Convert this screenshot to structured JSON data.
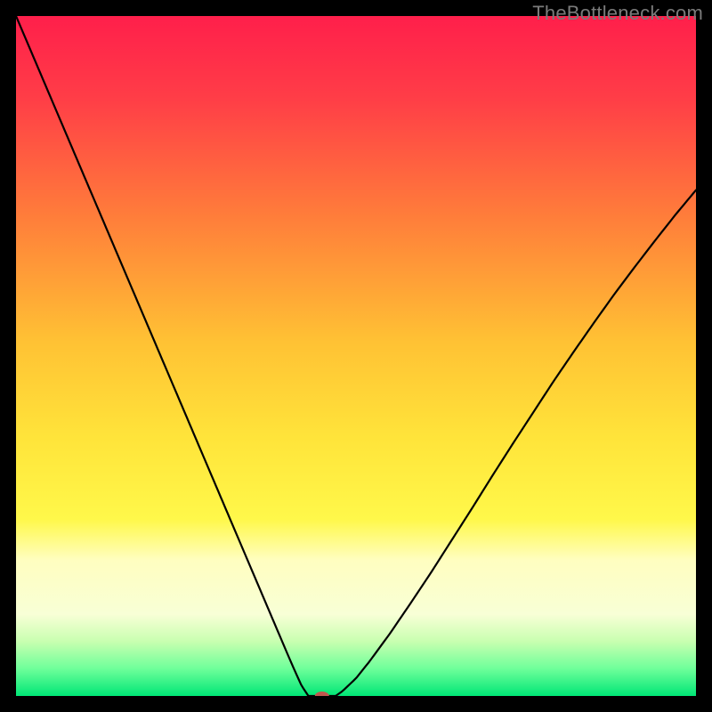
{
  "watermark": "TheBottleneck.com",
  "chart_data": {
    "type": "line",
    "title": "",
    "xlabel": "",
    "ylabel": "",
    "xlim": [
      0,
      100
    ],
    "ylim": [
      0,
      100
    ],
    "gradient_stops": [
      {
        "offset": 0.0,
        "color": "#ff1f4b"
      },
      {
        "offset": 0.12,
        "color": "#ff3d47"
      },
      {
        "offset": 0.3,
        "color": "#ff7f3a"
      },
      {
        "offset": 0.48,
        "color": "#ffc234"
      },
      {
        "offset": 0.62,
        "color": "#ffe43a"
      },
      {
        "offset": 0.74,
        "color": "#fff84a"
      },
      {
        "offset": 0.8,
        "color": "#fffec0"
      },
      {
        "offset": 0.88,
        "color": "#f8ffd6"
      },
      {
        "offset": 0.92,
        "color": "#c8ffb0"
      },
      {
        "offset": 0.96,
        "color": "#6eff9a"
      },
      {
        "offset": 1.0,
        "color": "#00e676"
      }
    ],
    "series": [
      {
        "name": "bottleneck-curve",
        "segment_left": {
          "x": [
            0,
            2,
            4,
            6,
            8,
            10,
            12,
            14,
            16,
            18,
            20,
            22,
            24,
            26,
            28,
            30,
            32,
            34,
            36,
            38,
            40,
            41,
            42,
            43
          ],
          "y": [
            100,
            95.3,
            90.6,
            85.9,
            81.2,
            76.5,
            71.8,
            67.1,
            62.4,
            57.7,
            53.0,
            48.3,
            43.6,
            38.9,
            34.2,
            29.5,
            24.8,
            20.1,
            15.4,
            10.7,
            6.0,
            3.7,
            1.5,
            0.0
          ]
        },
        "flat": {
          "x": [
            43,
            44,
            45,
            46,
            47
          ],
          "y": [
            0,
            0,
            0,
            0,
            0
          ]
        },
        "segment_right": {
          "x": [
            47,
            48,
            50,
            52,
            55,
            58,
            61,
            64,
            67,
            70,
            73,
            76,
            79,
            82,
            85,
            88,
            91,
            94,
            97,
            100
          ],
          "y": [
            0.0,
            0.7,
            2.6,
            5.1,
            9.2,
            13.6,
            18.1,
            22.8,
            27.5,
            32.3,
            37.0,
            41.6,
            46.2,
            50.6,
            54.9,
            59.1,
            63.1,
            67.0,
            70.8,
            74.4
          ]
        }
      }
    ],
    "marker": {
      "x": 45,
      "y": 0,
      "color": "#c1574e",
      "rx": 8,
      "ry": 5
    }
  }
}
